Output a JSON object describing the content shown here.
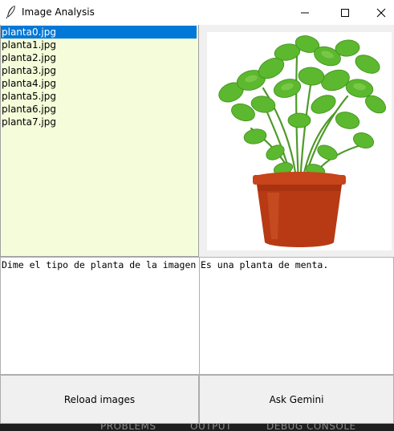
{
  "window": {
    "title": "Image Analysis",
    "controls": {
      "minimize": "minimize-icon",
      "maximize": "maximize-icon",
      "close": "close-icon"
    }
  },
  "image_list": {
    "items": [
      "planta0.jpg",
      "planta1.jpg",
      "planta2.jpg",
      "planta3.jpg",
      "planta4.jpg",
      "planta5.jpg",
      "planta6.jpg",
      "planta7.jpg"
    ],
    "selected_index": 0,
    "background_color": "#f5fcd9",
    "selection_color": "#0078d7"
  },
  "preview": {
    "image": "potted-mint-plant",
    "pot_color": "#b83a14",
    "leaf_color": "#5cb82e"
  },
  "question_box": {
    "value": "Dime el tipo de planta de la imagen"
  },
  "answer_box": {
    "value": "Es una planta de menta."
  },
  "buttons": {
    "reload_label": "Reload images",
    "ask_label": "Ask Gemini"
  },
  "background_panel": {
    "tabs": [
      "PROBLEMS",
      "OUTPUT",
      "DEBUG CONSOLE"
    ]
  }
}
